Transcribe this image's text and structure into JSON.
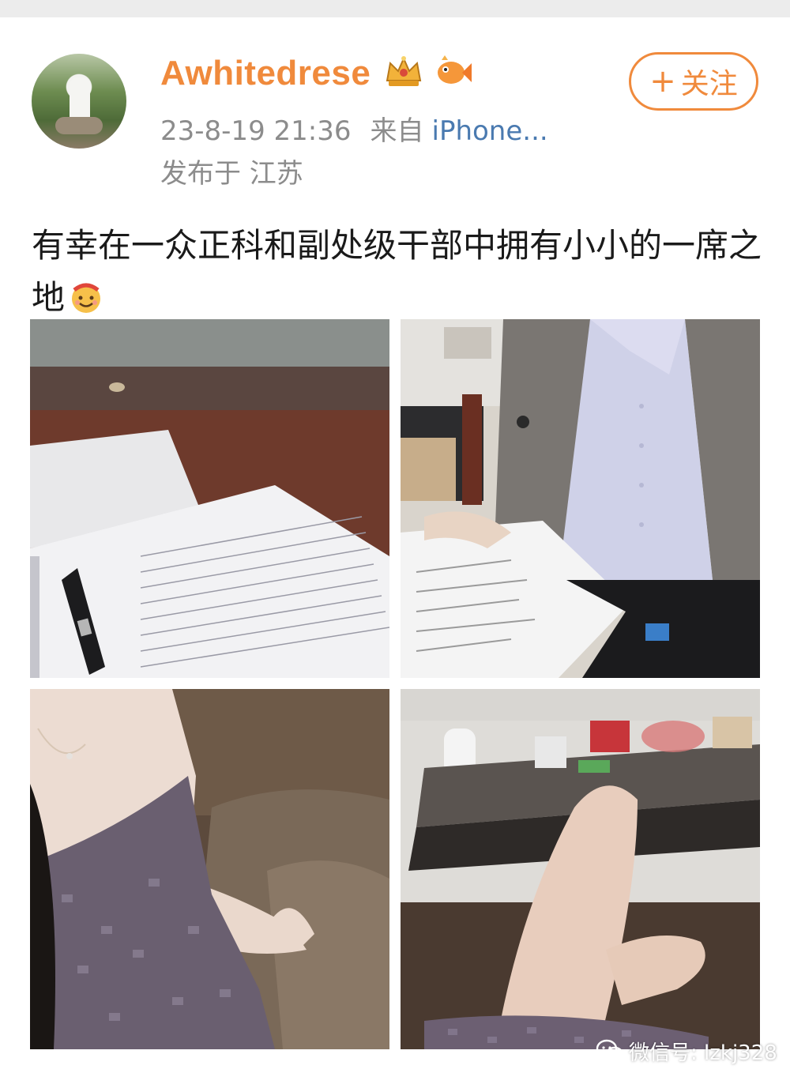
{
  "profile": {
    "username": "Awhitedrese",
    "date": "23-8-19 21:36",
    "source_label": "来自",
    "source": "iPhone...",
    "location": "发布于 江苏"
  },
  "follow_button": {
    "plus": "+",
    "label": "关注"
  },
  "post": {
    "text": "有幸在一众正科和副处级干部中拥有小小的一席之地"
  },
  "photos": [
    {
      "name": "notebook-photo"
    },
    {
      "name": "office-outfit-photo"
    },
    {
      "name": "tweed-dress-photo"
    },
    {
      "name": "sofa-table-photo"
    }
  ],
  "watermark": {
    "text": "微信号: lzkj328"
  },
  "colors": {
    "accent": "#f08a3c",
    "link": "#4a7ab0",
    "meta": "#8c8c8c"
  },
  "icons": [
    "avatar",
    "crown-badge-icon",
    "fish-badge-icon",
    "smile-emoji-icon",
    "wechat-icon"
  ]
}
